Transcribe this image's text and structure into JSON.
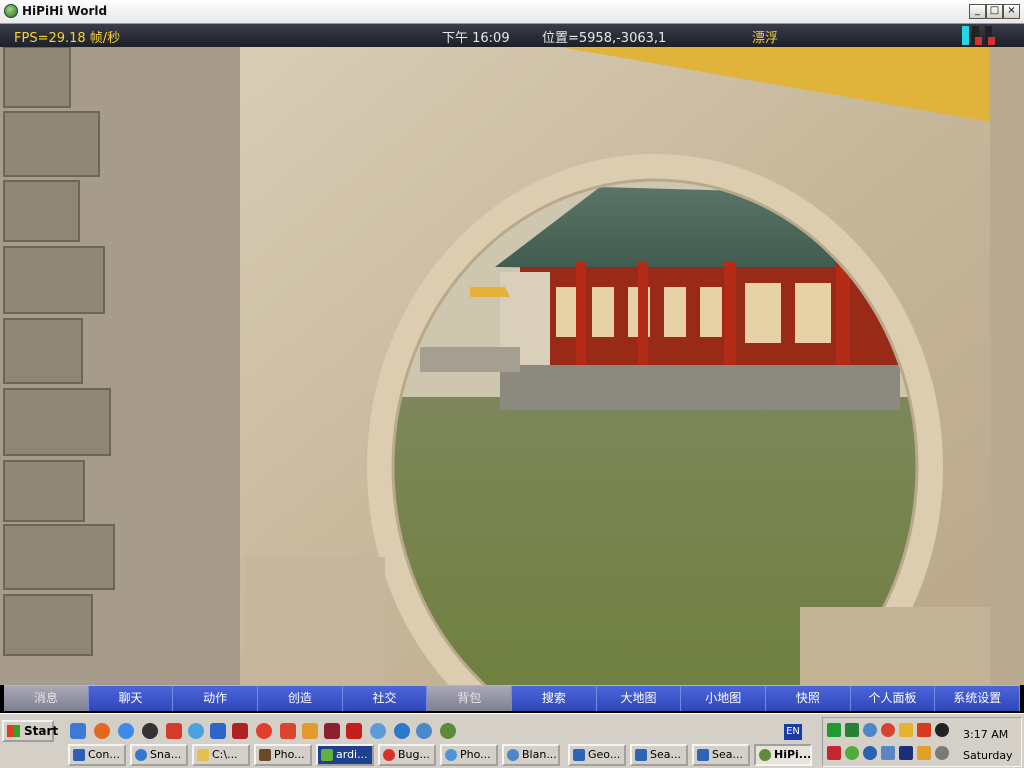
{
  "window": {
    "title": "HiPiHi World",
    "controls": {
      "minimize": "_",
      "maximize": "□",
      "close": "×"
    }
  },
  "hud": {
    "fps": "FPS=29.18 帧/秒",
    "clock": "下午 16:09",
    "position": "位置=5958,-3063,1",
    "mode": "漂浮"
  },
  "game_menu": {
    "items": [
      {
        "label": "消息",
        "enabled": false
      },
      {
        "label": "聊天",
        "enabled": true
      },
      {
        "label": "动作",
        "enabled": true
      },
      {
        "label": "创造",
        "enabled": true
      },
      {
        "label": "社交",
        "enabled": true
      },
      {
        "label": "背包",
        "enabled": false
      },
      {
        "label": "搜索",
        "enabled": true
      },
      {
        "label": "大地图",
        "enabled": true
      },
      {
        "label": "小地图",
        "enabled": true
      },
      {
        "label": "快照",
        "enabled": true
      },
      {
        "label": "个人面板",
        "enabled": true
      },
      {
        "label": "系统设置",
        "enabled": true
      }
    ]
  },
  "taskbar": {
    "start_label": "Start",
    "language": "EN",
    "tasks": [
      {
        "label": "Con...",
        "icon": "console-icon",
        "active": false
      },
      {
        "label": "Sna...",
        "icon": "snagit-icon",
        "active": false
      },
      {
        "label": "C:\\...",
        "icon": "folder-icon",
        "active": false
      },
      {
        "label": "Pho...",
        "icon": "photoshop-icon",
        "active": false
      },
      {
        "label": "ardi...",
        "icon": "app-icon",
        "active": false
      },
      {
        "label": "Bug...",
        "icon": "opera-icon",
        "active": false
      },
      {
        "label": "Pho...",
        "icon": "photo-icon",
        "active": false
      },
      {
        "label": "Blan...",
        "icon": "browser-icon",
        "active": false
      },
      {
        "label": "Geo...",
        "icon": "document-icon",
        "active": false
      },
      {
        "label": "Sea...",
        "icon": "document-icon",
        "active": false
      },
      {
        "label": "Sea...",
        "icon": "document-icon",
        "active": false
      },
      {
        "label": "HiPi...",
        "icon": "hipihi-icon",
        "active": true
      }
    ],
    "tray": {
      "time": "3:17 AM",
      "day": "Saturday"
    }
  },
  "colors": {
    "hud_yellow": "#f5d23a",
    "menu_blue": "#3b54c9",
    "taskbar_grey": "#d4d0c8"
  }
}
